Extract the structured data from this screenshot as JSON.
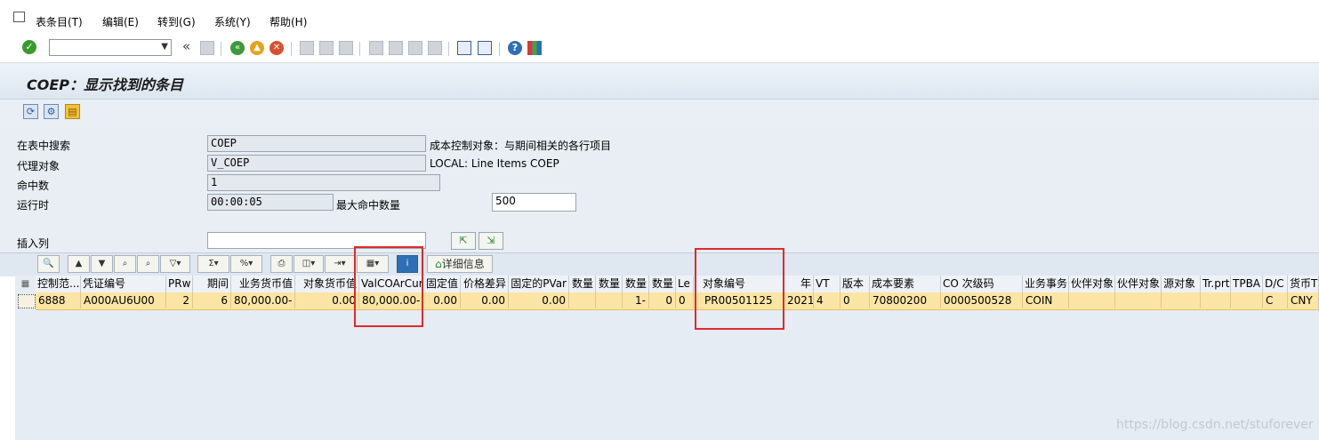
{
  "menubar": {
    "items": [
      "表条目(T)",
      "编辑(E)",
      "转到(G)",
      "系统(Y)",
      "帮助(H)"
    ]
  },
  "toolbar": {
    "command_value": "",
    "back_glyph": "«"
  },
  "title": "COEP：显示找到的条目",
  "form": {
    "search_label": "在表中搜索",
    "search_value": "COEP",
    "search_desc": "成本控制对象：与期间相关的各行项目",
    "proxy_label": "代理对象",
    "proxy_value": "V_COEP",
    "proxy_desc": "LOCAL: Line Items COEP",
    "hits_label": "命中数",
    "hits_value": "1",
    "runtime_label": "运行时",
    "runtime_value": "00:00:05",
    "maxhits_label": "最大命中数量",
    "maxhits_value": "500",
    "insert_label": "插入列",
    "insert_value": ""
  },
  "alv": {
    "detail_label": "详细信息"
  },
  "grid": {
    "columns": [
      "控制范...",
      "凭证编号",
      "PRw",
      "期间",
      "业务货币值",
      "对象货币值",
      "ValCOArCur",
      "固定值",
      "价格差异",
      "固定的PVar",
      "数量",
      "数量",
      "数量",
      "数量",
      "Le",
      "对象编号",
      "年",
      "VT",
      "版本",
      "成本要素",
      "CO 次级码",
      "业务事务",
      "伙伴对象",
      "伙伴对象",
      "源对象",
      "Tr.prt",
      "TPBA",
      "D/C",
      "货币T"
    ],
    "row": [
      "6888",
      "A000AU6U00",
      "2",
      "6",
      "80,000.00-",
      "0.00",
      "80,000.00-",
      "0.00",
      "0.00",
      "0.00",
      "",
      "",
      "1-",
      "0",
      "0",
      "PR00501125",
      "2021",
      "4",
      "0",
      "70800200",
      "0000500528",
      "COIN",
      "",
      "",
      "",
      "",
      "",
      "C",
      "CNY"
    ]
  },
  "watermark": "https://blog.csdn.net/stuforever",
  "colors": {
    "highlight_row": "#fbe5a4",
    "annotation_box": "#e02a2a"
  }
}
